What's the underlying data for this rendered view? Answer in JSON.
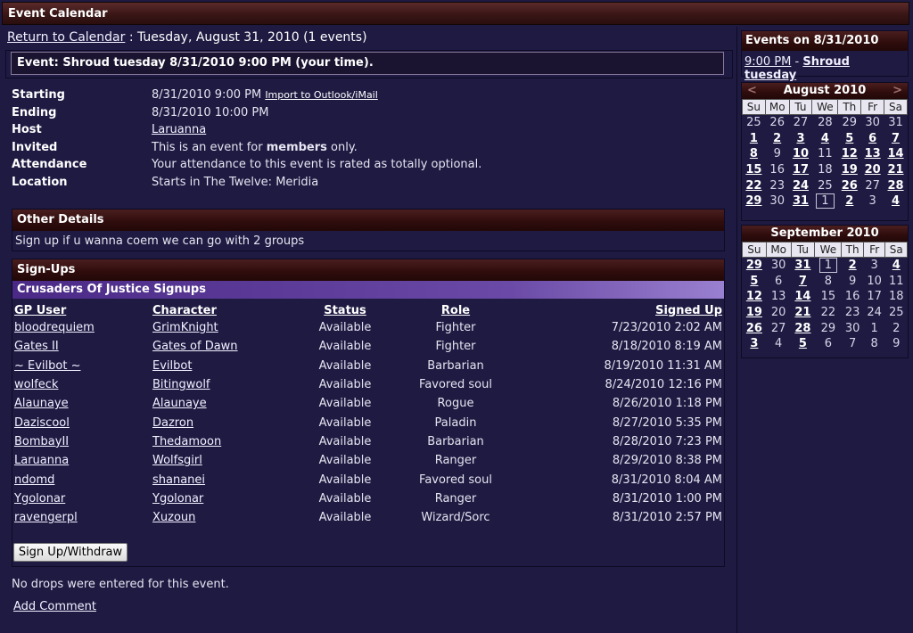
{
  "window": {
    "title": "Event Calendar"
  },
  "breadcrumb": {
    "link": "Return to Calendar",
    "separator": " : ",
    "date_text": "Tuesday, August 31, 2010 (1 events)"
  },
  "event": {
    "header": "Event: Shroud tuesday 8/31/2010 9:00 PM (your time).",
    "details": [
      {
        "label": "Starting",
        "value": "8/31/2010 9:00 PM",
        "extra_link": "Import to Outlook/iMail"
      },
      {
        "label": "Ending",
        "value": "8/31/2010 10:00 PM"
      },
      {
        "label": "Host",
        "value_link": "Laruanna"
      },
      {
        "label": "Invited",
        "value_pre": "This is an event for ",
        "value_bold": "members",
        "value_post": " only."
      },
      {
        "label": "Attendance",
        "value": "Your attendance to this event is rated as totally optional."
      },
      {
        "label": "Location",
        "value": "Starts in The Twelve: Meridia"
      }
    ]
  },
  "other_details": {
    "title": "Other Details",
    "text": "Sign up if u wanna coem we can go with 2 groups"
  },
  "signups": {
    "title": "Sign-Ups",
    "group_title": "Crusaders Of Justice Signups",
    "columns": [
      "GP User",
      "Character",
      "Status",
      "Role",
      "Signed Up"
    ],
    "rows": [
      [
        "bloodrequiem",
        "GrimKnight",
        "Available",
        "Fighter",
        "7/23/2010 2:02 AM"
      ],
      [
        "Gates II",
        "Gates of Dawn",
        "Available",
        "Fighter",
        "8/18/2010 8:19 AM"
      ],
      [
        "~ Evilbot ~",
        "Evilbot",
        "Available",
        "Barbarian",
        "8/19/2010 11:31 AM"
      ],
      [
        "wolfeck",
        "Bitingwolf",
        "Available",
        "Favored soul",
        "8/24/2010 12:16 PM"
      ],
      [
        "Alaunaye",
        "Alaunaye",
        "Available",
        "Rogue",
        "8/26/2010 1:18 PM"
      ],
      [
        "Daziscool",
        "Dazron",
        "Available",
        "Paladin",
        "8/27/2010 5:35 PM"
      ],
      [
        "BombayII",
        "Thedamoon",
        "Available",
        "Barbarian",
        "8/28/2010 7:23 PM"
      ],
      [
        "Laruanna",
        "Wolfsgirl",
        "Available",
        "Ranger",
        "8/29/2010 8:38 PM"
      ],
      [
        "ndomd",
        "shananei",
        "Available",
        "Favored soul",
        "8/31/2010 8:04 AM"
      ],
      [
        "Ygolonar",
        "Ygolonar",
        "Available",
        "Ranger",
        "8/31/2010 1:00 PM"
      ],
      [
        "ravengerpl",
        "Xuzoun",
        "Available",
        "Wizard/Sorc",
        "8/31/2010 2:57 PM"
      ]
    ],
    "button": "Sign Up/Withdraw"
  },
  "footer": {
    "no_drops": "No drops were entered for this event.",
    "add_comment": "Add Comment"
  },
  "sidebar": {
    "events_title": "Events on 8/31/2010",
    "event_time": "9:00 PM",
    "event_sep": " - ",
    "event_name": "Shroud tuesday",
    "weekdays": [
      "Su",
      "Mo",
      "Tu",
      "We",
      "Th",
      "Fr",
      "Sa"
    ],
    "prev": "<",
    "next": ">",
    "months": [
      {
        "title": "August 2010",
        "nav": true,
        "weeks": [
          [
            "25",
            "26",
            "27",
            "28",
            "29",
            "30",
            "31"
          ],
          [
            "1",
            "2",
            "3",
            "4",
            "5",
            "6",
            "7"
          ],
          [
            "8",
            "9",
            "10",
            "11",
            "12",
            "13",
            "14"
          ],
          [
            "15",
            "16",
            "17",
            "18",
            "19",
            "20",
            "21"
          ],
          [
            "22",
            "23",
            "24",
            "25",
            "26",
            "27",
            "28"
          ],
          [
            "29",
            "30",
            "31",
            "1",
            "2",
            "3",
            "4"
          ]
        ],
        "event_days": [
          "1",
          "3",
          "5",
          "6",
          "7",
          "8",
          "10",
          "12",
          "13",
          "14",
          "15",
          "17",
          "19",
          "20",
          "21",
          "22",
          "24",
          "26",
          "28",
          "29",
          "31",
          "2",
          "4"
        ],
        "other_month_rows": {
          "0": [
            0,
            1,
            2,
            3,
            4,
            5,
            6
          ],
          "5": [
            3,
            4,
            5,
            6
          ]
        },
        "today": [
          5,
          3
        ]
      },
      {
        "title": "September 2010",
        "nav": false,
        "weeks": [
          [
            "29",
            "30",
            "31",
            "1",
            "2",
            "3",
            "4"
          ],
          [
            "5",
            "6",
            "7",
            "8",
            "9",
            "10",
            "11"
          ],
          [
            "12",
            "13",
            "14",
            "15",
            "16",
            "17",
            "18"
          ],
          [
            "19",
            "20",
            "21",
            "22",
            "23",
            "24",
            "25"
          ],
          [
            "26",
            "27",
            "28",
            "29",
            "30",
            "1",
            "2"
          ],
          [
            "3",
            "4",
            "5",
            "6",
            "7",
            "8",
            "9"
          ]
        ],
        "event_cells": [
          [
            0,
            0
          ],
          [
            0,
            2
          ],
          [
            0,
            4
          ],
          [
            0,
            6
          ],
          [
            1,
            0
          ],
          [
            1,
            2
          ],
          [
            2,
            0
          ],
          [
            2,
            2
          ],
          [
            3,
            0
          ],
          [
            3,
            2
          ],
          [
            4,
            0
          ],
          [
            4,
            2
          ],
          [
            5,
            0
          ],
          [
            5,
            2
          ]
        ],
        "today": [
          0,
          3
        ]
      }
    ]
  },
  "colors": {
    "background": "#1e1a42",
    "header_bar": "#3a1616",
    "group_bar": "#6a4aa6"
  }
}
